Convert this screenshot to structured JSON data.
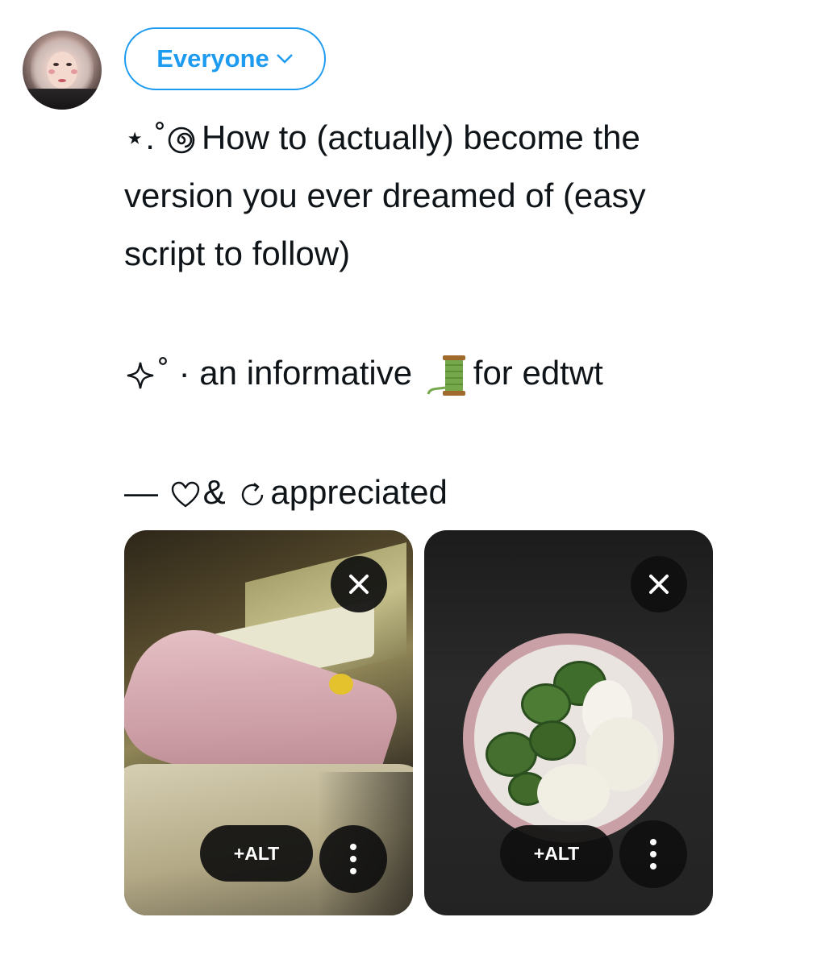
{
  "composer": {
    "audience_label": "Everyone",
    "icons": {
      "audience_caret": "chevron-down-icon",
      "remove": "close-icon",
      "more": "more-vertical-icon"
    },
    "accent_color": "#1d9bf0"
  },
  "post": {
    "line1": "⋆.˚🌀 How to (actually) become the",
    "line1_prefix": "⋆.˚",
    "line1_text": "How to (actually) become the",
    "line2": "version you ever dreamed of (easy",
    "line3": "script to follow)",
    "line4_prefix": "˚ · an informative",
    "line4_suffix": "for edtwt",
    "line5_dash": "—",
    "line5_amp": "&",
    "line5_text": "appreciated"
  },
  "media": [
    {
      "alt_label": "+ALT"
    },
    {
      "alt_label": "+ALT"
    }
  ]
}
